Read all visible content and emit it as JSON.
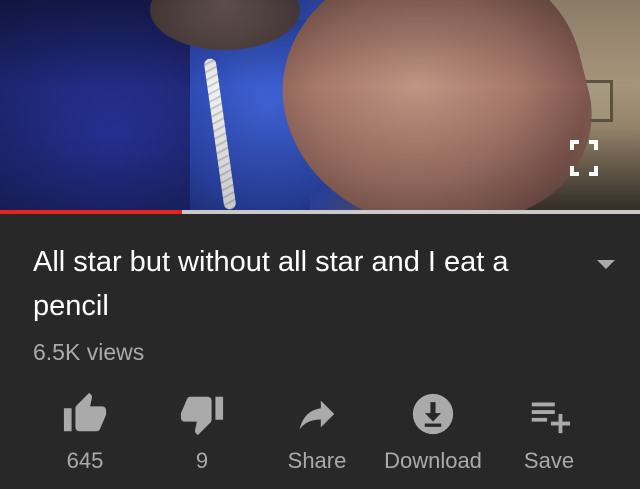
{
  "video": {
    "progress_fraction": 0.285,
    "colors": {
      "progress_played": "#e52420",
      "progress_buffered": "#c9c9c9"
    }
  },
  "fullscreen": {
    "icon": "fullscreen-icon"
  },
  "info": {
    "title": "All star but without all star and I eat a pencil",
    "views": "6.5K views",
    "expand_icon": "chevron-down-icon"
  },
  "actions": {
    "like": {
      "icon": "thumbs-up-icon",
      "label": "645"
    },
    "dislike": {
      "icon": "thumbs-down-icon",
      "label": "9"
    },
    "share": {
      "icon": "share-icon",
      "label": "Share"
    },
    "download": {
      "icon": "download-icon",
      "label": "Download"
    },
    "save": {
      "icon": "playlist-add-icon",
      "label": "Save"
    }
  },
  "theme": {
    "background": "#282828",
    "icon_color": "#aaaaaa",
    "text": "#ffffff"
  }
}
